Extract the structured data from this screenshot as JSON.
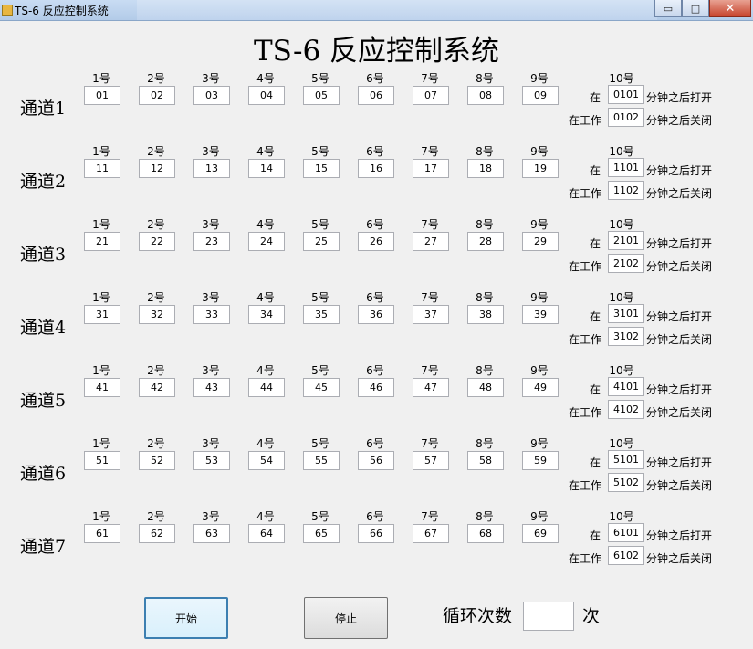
{
  "window": {
    "title": "TS-6 反应控制系统",
    "minimize": "▭",
    "maximize": "□",
    "close": "✕"
  },
  "header": {
    "title": "TS-6  反应控制系统"
  },
  "labels": {
    "at": "在",
    "at_work": "在工作",
    "after_open": "分钟之后打开",
    "after_close": "分钟之后关闭",
    "num10": "10号"
  },
  "num_labels": [
    "1号",
    "2号",
    "3号",
    "4号",
    "5号",
    "6号",
    "7号",
    "8号",
    "9号"
  ],
  "channels": [
    {
      "name": "通道1",
      "values": [
        "01",
        "02",
        "03",
        "04",
        "05",
        "06",
        "07",
        "08",
        "09"
      ],
      "open": "0101",
      "close": "0102"
    },
    {
      "name": "通道2",
      "values": [
        "11",
        "12",
        "13",
        "14",
        "15",
        "16",
        "17",
        "18",
        "19"
      ],
      "open": "1101",
      "close": "1102"
    },
    {
      "name": "通道3",
      "values": [
        "21",
        "22",
        "23",
        "24",
        "25",
        "26",
        "27",
        "28",
        "29"
      ],
      "open": "2101",
      "close": "2102"
    },
    {
      "name": "通道4",
      "values": [
        "31",
        "32",
        "33",
        "34",
        "35",
        "36",
        "37",
        "38",
        "39"
      ],
      "open": "3101",
      "close": "3102"
    },
    {
      "name": "通道5",
      "values": [
        "41",
        "42",
        "43",
        "44",
        "45",
        "46",
        "47",
        "48",
        "49"
      ],
      "open": "4101",
      "close": "4102"
    },
    {
      "name": "通道6",
      "values": [
        "51",
        "52",
        "53",
        "54",
        "55",
        "56",
        "57",
        "58",
        "59"
      ],
      "open": "5101",
      "close": "5102"
    },
    {
      "name": "通道7",
      "values": [
        "61",
        "62",
        "63",
        "64",
        "65",
        "66",
        "67",
        "68",
        "69"
      ],
      "open": "6101",
      "close": "6102"
    }
  ],
  "controls": {
    "start": "开始",
    "stop": "停止",
    "cycle_label": "循环次数",
    "cycle_value": "",
    "cycle_unit": "次"
  }
}
